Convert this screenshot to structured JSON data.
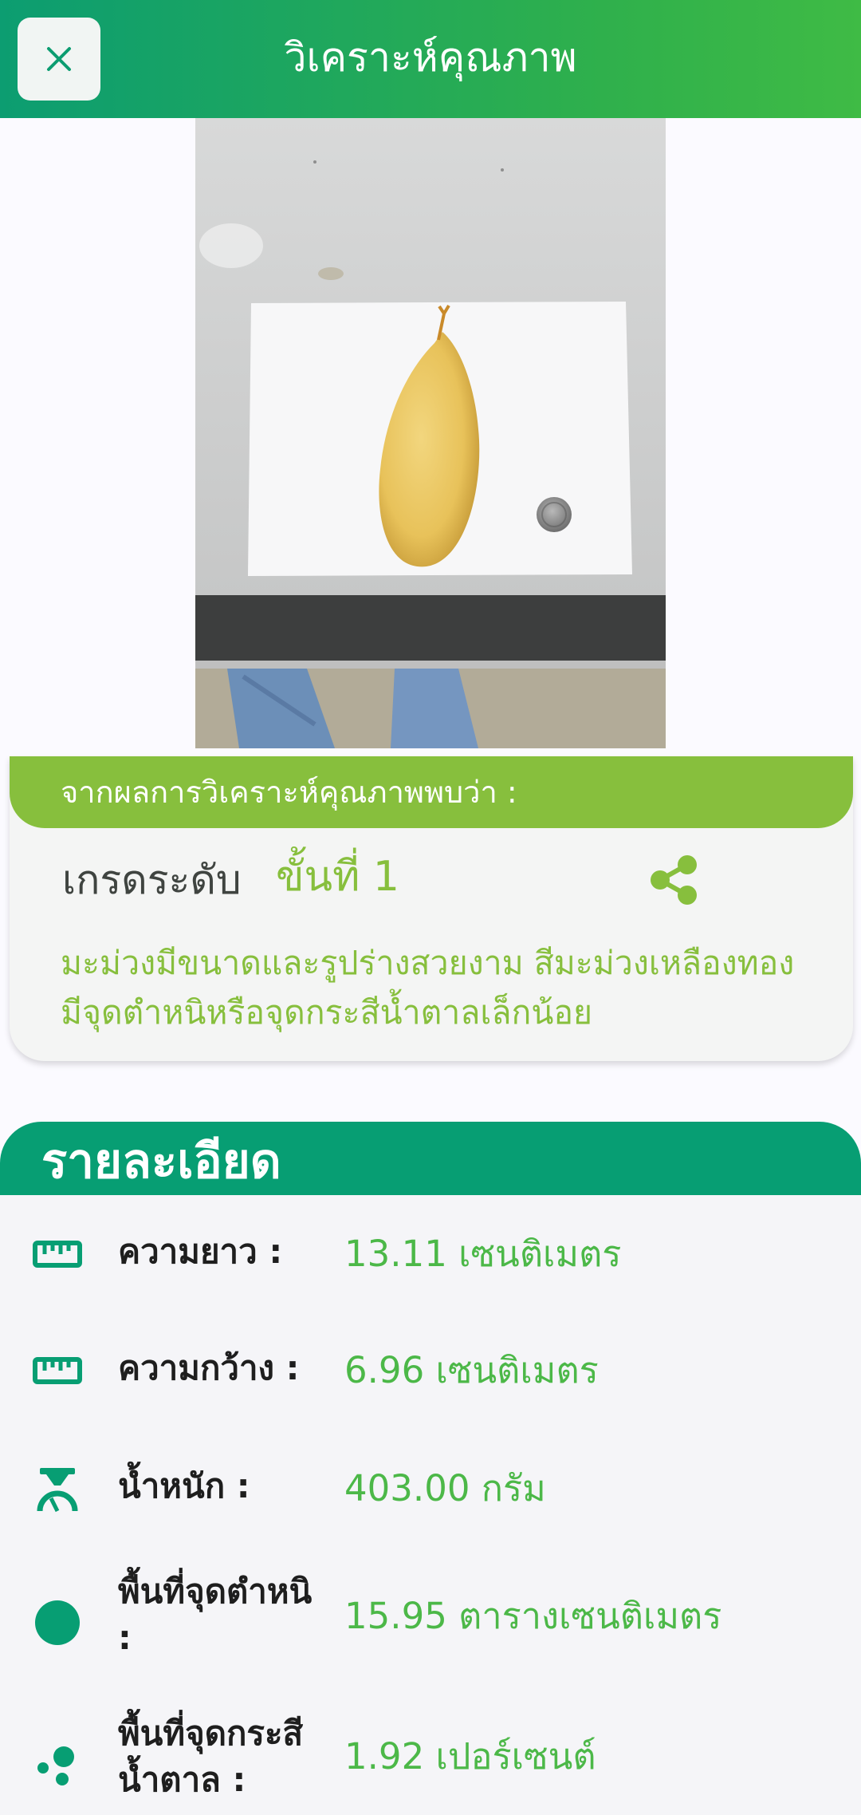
{
  "header": {
    "title": "วิเคราะห์คุณภาพ"
  },
  "result": {
    "banner": "จากผลการวิเคราะห์คุณภาพพบว่า :",
    "grade_label": "เกรดระดับ",
    "grade_value": "ขั้นที่ 1",
    "description": "มะม่วงมีขนาดและรูปร่างสวยงาม สีมะม่วงเหลืองทอง มีจุดตำหนิหรือจุดกระสีน้ำตาลเล็กน้อย"
  },
  "details": {
    "title": "รายละเอียด",
    "rows": [
      {
        "icon": "ruler-icon",
        "label": "ความยาว :",
        "value": "13.11 เซนติเมตร"
      },
      {
        "icon": "ruler-icon",
        "label": "ความกว้าง :",
        "value": "6.96 เซนติเมตร"
      },
      {
        "icon": "scale-icon",
        "label": "น้ำหนัก :",
        "value": "403.00 กรัม"
      },
      {
        "icon": "circle-icon",
        "label": "พื้นที่จุดตำหนิ :",
        "value": "15.95 ตารางเซนติเมตร"
      },
      {
        "icon": "dots-icon",
        "label": "พื้นที่จุดกระสีน้ำตาล :",
        "value": "1.92 เปอร์เซนต์"
      }
    ]
  },
  "colors": {
    "header_start": "#0c9d71",
    "header_end": "#3fbb45",
    "accent_green": "#87bf3d",
    "value_green": "#4cb848",
    "details_header": "#079e73"
  }
}
